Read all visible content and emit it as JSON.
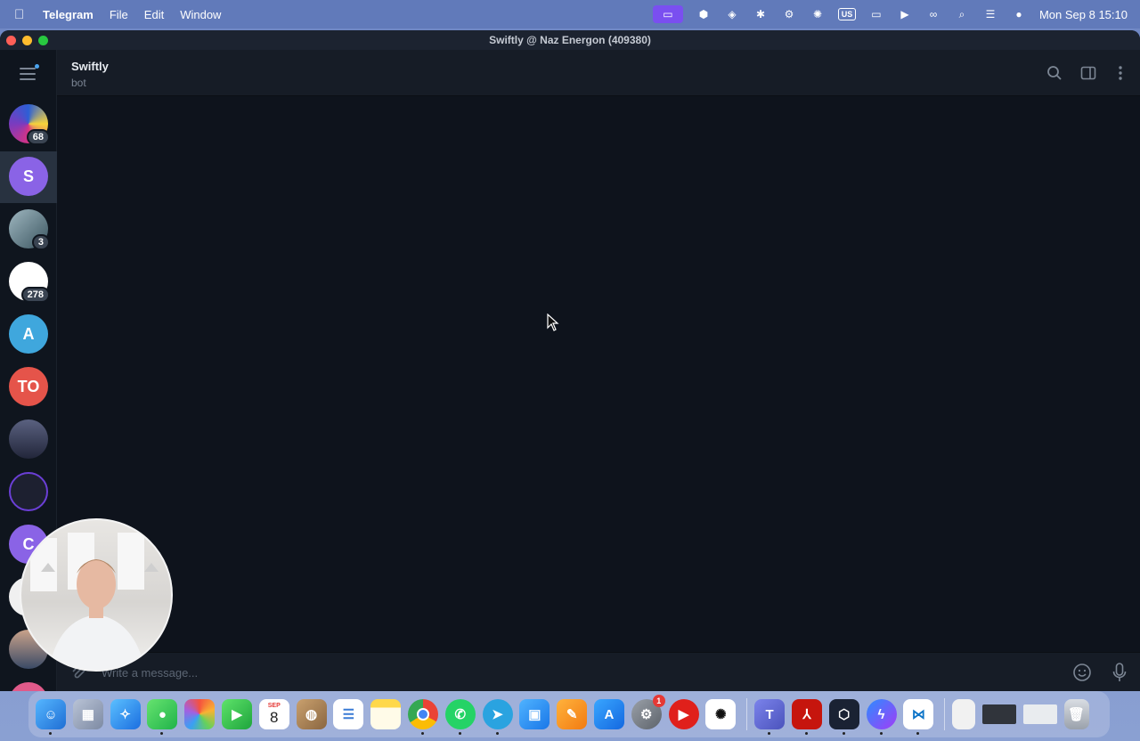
{
  "menubar": {
    "apple_icon": "apple-logo-icon",
    "app_name": "Telegram",
    "items": [
      "File",
      "Edit",
      "Window"
    ],
    "clock": "Mon Sep 8  15:10",
    "keyboard_layout": "US"
  },
  "window": {
    "title": "Swiftly @ Naz Energon (409380)"
  },
  "chat": {
    "name": "Swiftly",
    "status": "bot",
    "composer_placeholder": "Write a message..."
  },
  "rail": {
    "chats": [
      {
        "initials": "",
        "badge": "68",
        "color": "#7a3bbf"
      },
      {
        "initials": "S",
        "badge": "",
        "color": "#8a63e6",
        "selected": true
      },
      {
        "initials": "",
        "badge": "3",
        "color": "#5e7b88"
      },
      {
        "initials": "",
        "badge": "278",
        "color": "#ffffff"
      },
      {
        "initials": "A",
        "badge": "",
        "color": "#3fa7dd"
      },
      {
        "initials": "TO",
        "badge": "",
        "color": "#e5544a"
      },
      {
        "initials": "",
        "badge": "",
        "color": "#3a3f52"
      },
      {
        "initials": "",
        "badge": "",
        "color": "#1d2030"
      },
      {
        "initials": "C",
        "badge": "",
        "color": "#8a63e6"
      }
    ]
  },
  "dock": {
    "calendar_month": "SEP",
    "calendar_day": "8",
    "settings_badge": "1"
  }
}
